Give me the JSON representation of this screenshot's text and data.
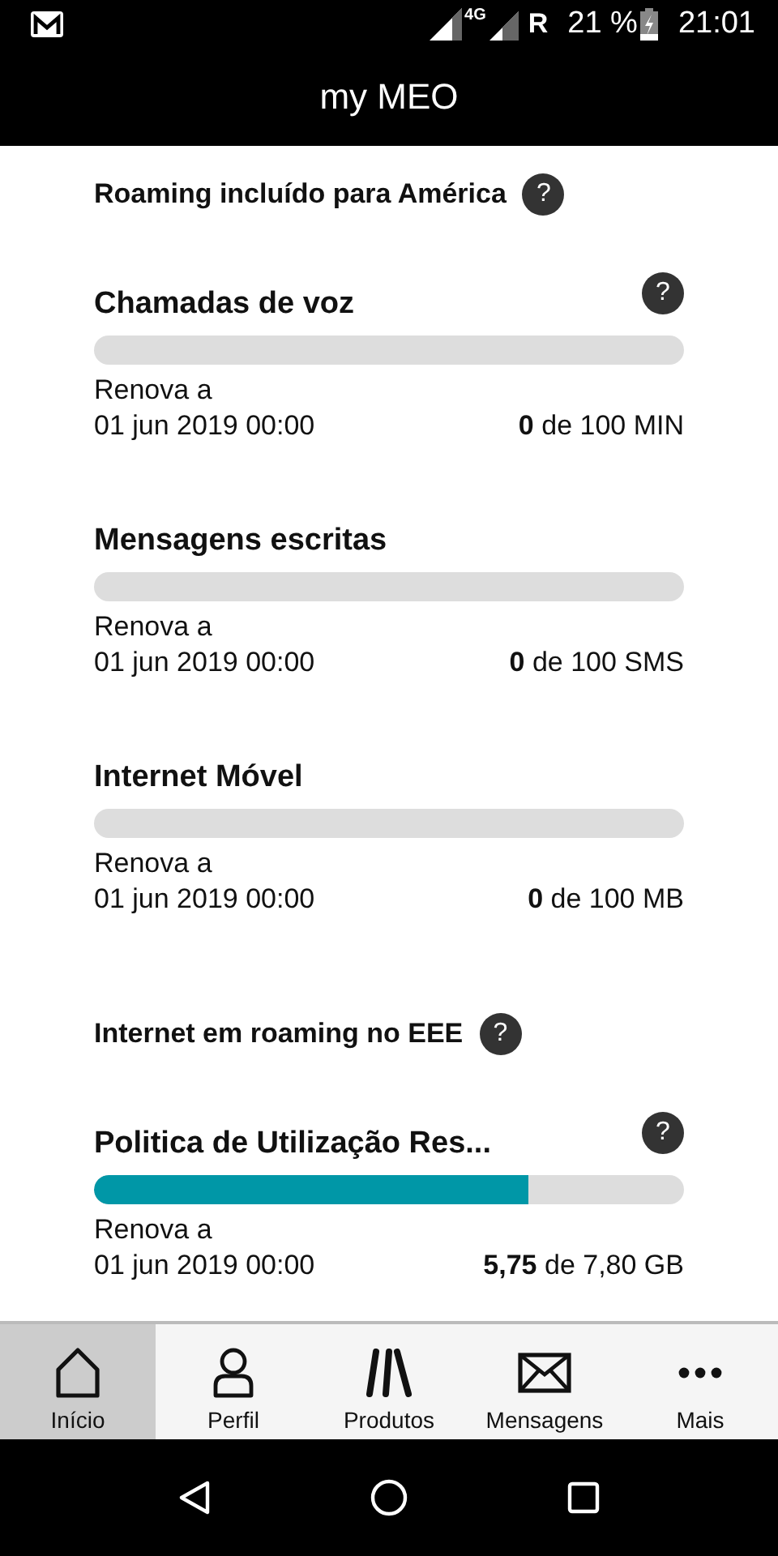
{
  "status_bar": {
    "network": "4G",
    "roaming": "R",
    "battery": "21 %",
    "time": "21:01"
  },
  "app_bar": {
    "title": "my MEO"
  },
  "sections": [
    {
      "heading": "Roaming incluído para América",
      "help": "?",
      "items": [
        {
          "title": "Chamadas de voz",
          "help": "?",
          "level": 0,
          "renew_label": "Renova a",
          "renew_date": "01 jun 2019 00:00",
          "usage": "**0** de 100 MIN"
        },
        {
          "title": "Mensagens escritas",
          "level": 0,
          "renew_label": "Renova a",
          "renew_date": "01 jun 2019 00:00",
          "usage": "**0** de 100 SMS"
        },
        {
          "title": "Internet Móvel",
          "level": 0,
          "renew_label": "Renova a",
          "renew_date": "01 jun 2019 00:00",
          "usage": "**0** de 100 MB"
        }
      ]
    },
    {
      "heading": "Internet em roaming no EEE",
      "help": "?",
      "items": [
        {
          "title": "Politica de Utilização Res...",
          "help": "?",
          "level": 0.737,
          "renew_label": "Renova a",
          "renew_date": "01 jun 2019 00:00",
          "usage": "**5,75** de 7,80 GB"
        }
      ]
    }
  ],
  "bottom_nav": [
    {
      "kind": "home",
      "label": "Início",
      "selected": true
    },
    {
      "kind": "person",
      "label": "Perfil",
      "selected": false
    },
    {
      "kind": "products",
      "label": "Produtos",
      "selected": false
    },
    {
      "kind": "mail",
      "label": "Mensagens",
      "selected": false
    },
    {
      "kind": "more",
      "label": "Mais",
      "selected": false
    }
  ]
}
